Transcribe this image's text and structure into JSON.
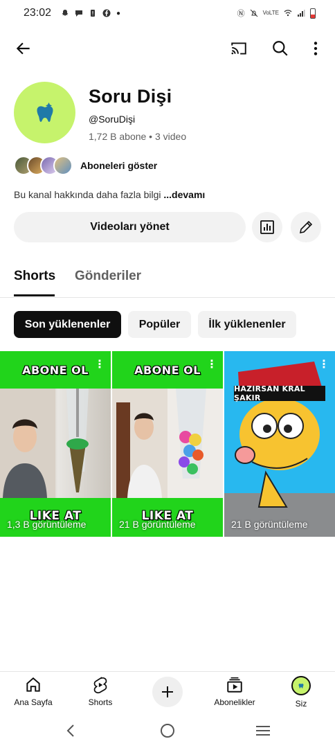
{
  "status_bar": {
    "time": "23:02",
    "network_label": "VoLTE",
    "battery_color": "#e53935"
  },
  "app_bar": {
    "back_icon": "arrow-left-icon",
    "cast_icon": "cast-icon",
    "search_icon": "search-icon",
    "more_icon": "more-vert-icon"
  },
  "channel": {
    "name": "Soru Dişi",
    "handle": "@SoruDişi",
    "stats": "1,72 B abone • 3 video",
    "avatar_color": "#c6f36c",
    "show_subscribers_label": "Aboneleri göster",
    "about_text": "Bu kanal hakkında daha fazla bilgi",
    "about_more": "...devamı",
    "manage_videos_label": "Videoları yönet"
  },
  "tabs": [
    {
      "label": "Shorts",
      "active": true
    },
    {
      "label": "Gönderiler",
      "active": false
    }
  ],
  "chips": [
    {
      "label": "Son yüklenenler",
      "selected": true
    },
    {
      "label": "Popüler",
      "selected": false
    },
    {
      "label": "İlk yüklenenler",
      "selected": false
    }
  ],
  "shorts": [
    {
      "top_text": "ABONE OL",
      "bottom_text": "LIKE AT",
      "views": "1,3 B görüntüleme"
    },
    {
      "top_text": "ABONE OL",
      "bottom_text": "LIKE AT",
      "views": "21 B görüntüleme"
    },
    {
      "top_text": "HAZIRSAN KRAL ŞAKIR",
      "bottom_text": "",
      "views": "21 B görüntüleme"
    }
  ],
  "bottom_nav": [
    {
      "label": "Ana Sayfa",
      "icon": "home-icon"
    },
    {
      "label": "Shorts",
      "icon": "shorts-icon"
    },
    {
      "label": "",
      "icon": "plus-icon"
    },
    {
      "label": "Abonelikler",
      "icon": "subscriptions-icon"
    },
    {
      "label": "Siz",
      "icon": "avatar"
    }
  ],
  "accent_green": "#21d41b"
}
